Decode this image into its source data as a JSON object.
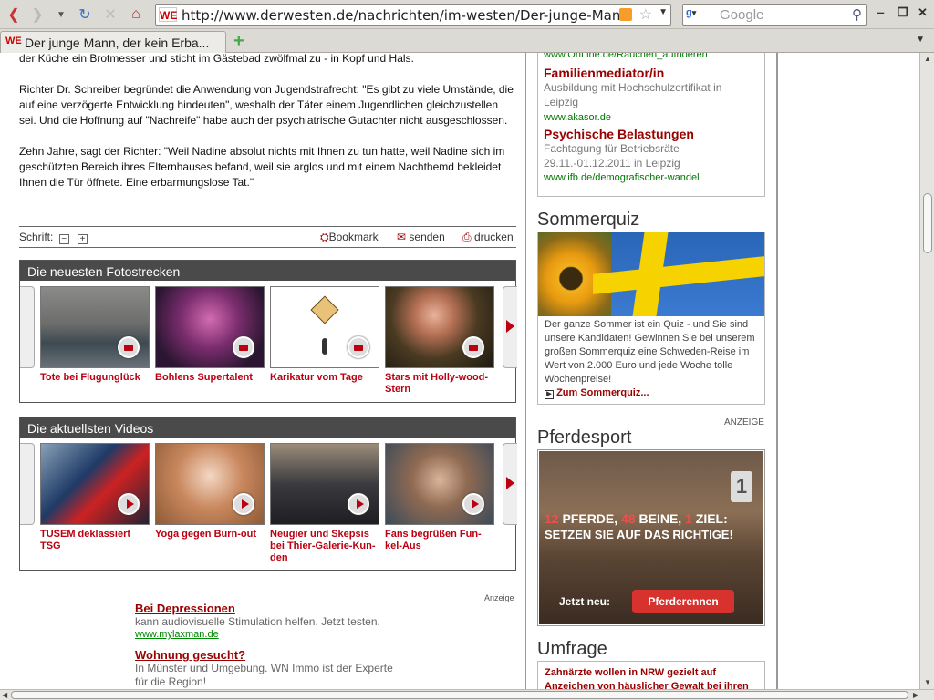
{
  "browser": {
    "url": "http://www.derwesten.de/nachrichten/im-westen/Der-junge-Mann-der-",
    "site_icon": "WE",
    "search_placeholder": "Google",
    "tab_title": "Der junge Mann, der kein Erba...",
    "tab_icon": "WE"
  },
  "article": {
    "para1": "der Küche ein Brotmesser und sticht im Gästebad zwölfmal zu - in Kopf und Hals.",
    "para2": "Richter Dr. Schreiber begründet die Anwendung von Jugendstrafrecht: \"Es gibt zu viele Umstände, die auf eine verzögerte Entwicklung hindeuten\", weshalb der Täter einem Jugendlichen gleichzustellen sei. Und die Hoffnung auf \"Nachreife\" habe auch der psychiatrische Gutachter nicht ausgeschlossen.",
    "para3": "Zehn Jahre, sagt der Richter: \"Weil Nadine absolut nichts mit Ihnen zu tun hatte, weil Nadine sich im geschützten Bereich ihres Elternhauses befand, weil sie arglos und mit einem Nachthemd bekleidet Ihnen die Tür öffnete. Eine erbarmungslose Tat.\""
  },
  "toolbar": {
    "schrift_label": "Schrift:",
    "minus": "−",
    "plus": "+",
    "bookmark": "Bookmark",
    "senden": "senden",
    "drucken": "drucken"
  },
  "fotostrecken": {
    "title": "Die neuesten Fotostrecken",
    "items": [
      {
        "caption": "Tote bei Flugunglück"
      },
      {
        "caption": "Bohlens Supertalent"
      },
      {
        "caption": "Karikatur vom Tage"
      },
      {
        "caption": "Stars mit Holly-wood-Stern"
      }
    ]
  },
  "videos": {
    "title": "Die aktuellsten Videos",
    "items": [
      {
        "caption": "TUSEM deklassiert TSG"
      },
      {
        "caption": "Yoga gegen Burn-out"
      },
      {
        "caption": "Neugier und Skepsis bei Thier-Galerie-Kun-den"
      },
      {
        "caption": "Fans begrüßen Fun-kel-Aus"
      }
    ]
  },
  "ads_left": {
    "label": "Anzeige",
    "items": [
      {
        "title": "Bei Depressionen",
        "desc": "kann audiovisuelle Stimulation helfen. Jetzt testen.",
        "url": "www.mylaxman.de"
      },
      {
        "title": "Wohnung gesucht?",
        "desc": "In Münster und Umgebung. WN Immo ist der Experte für die Region!"
      }
    ]
  },
  "right": {
    "top_url": "www.OnLine.de/Rauchen_aufhoeren",
    "ad1": {
      "title": "Familienmediator/in",
      "desc": "Ausbildung mit Hochschulzertifikat in Leipzig",
      "url": "www.akasor.de"
    },
    "ad2": {
      "title": "Psychische Belastungen",
      "desc": "Fachtagung für Betriebsräte 29.11.-01.12.2011 in Leipzig",
      "url": "www.ifb.de/demografischer-wandel"
    },
    "sommerquiz": {
      "heading": "Sommerquiz",
      "text": "Der ganze Sommer ist ein Quiz - und Sie sind unsere Kandidaten! Gewinnen Sie bei unserem großen Sommerquiz eine Schweden-Reise im Wert von 2.000 Euro und jede Woche tolle Wochenpreise!",
      "link": "Zum Sommerquiz..."
    },
    "anzeige": "ANZEIGE",
    "pferdesport": {
      "heading": "Pferdesport",
      "banner_line1_n1": "12",
      "banner_line1_t1": " PFERDE, ",
      "banner_line1_n2": "48",
      "banner_line1_t2": " BEINE, ",
      "banner_line1_n3": "1",
      "banner_line1_t3": " ZIEL:",
      "banner_line2": "SETZEN SIE AUF DAS RICHTIGE!",
      "jetzt": "Jetzt neu:",
      "button": "Pferderennen",
      "number": "1"
    },
    "umfrage": {
      "heading": "Umfrage",
      "question": "Zahnärzte wollen in NRW gezielt auf Anzeichen von häuslicher Gewalt bei ihren"
    }
  }
}
